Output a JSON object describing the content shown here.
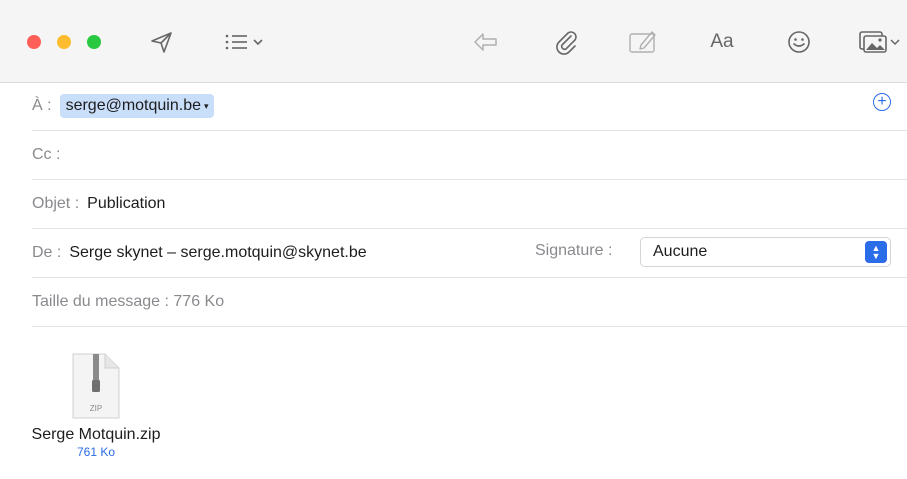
{
  "window": {
    "traffic_lights": {
      "close_color": "#ff5f57",
      "minimize_color": "#febc2e",
      "zoom_color": "#28c840"
    }
  },
  "toolbar": {
    "icons": [
      "send-icon",
      "list-icon",
      "chevron-down-icon",
      "reply-icon",
      "paperclip-icon",
      "markup-icon",
      "format-icon",
      "emoji-icon",
      "photo-browser-icon",
      "chevron-down-icon"
    ],
    "format_label": "Aa"
  },
  "header": {
    "to_label": "À :",
    "to_value": "serge@motquin.be",
    "cc_label": "Cc :",
    "subject_label": "Objet :",
    "subject_value": "Publication",
    "from_label": "De :",
    "from_value": "Serge skynet – serge.motquin@skynet.be",
    "signature_label": "Signature :",
    "signature_value": "Aucune",
    "size_text": "Taille du message : 776 Ko"
  },
  "attachment": {
    "type_label": "ZIP",
    "name": "Serge Motquin.zip",
    "size": "761 Ko"
  },
  "colors": {
    "accent": "#2b6ce8",
    "token_bg": "#c9def8",
    "toolbar_bg": "#f6f5f5"
  }
}
